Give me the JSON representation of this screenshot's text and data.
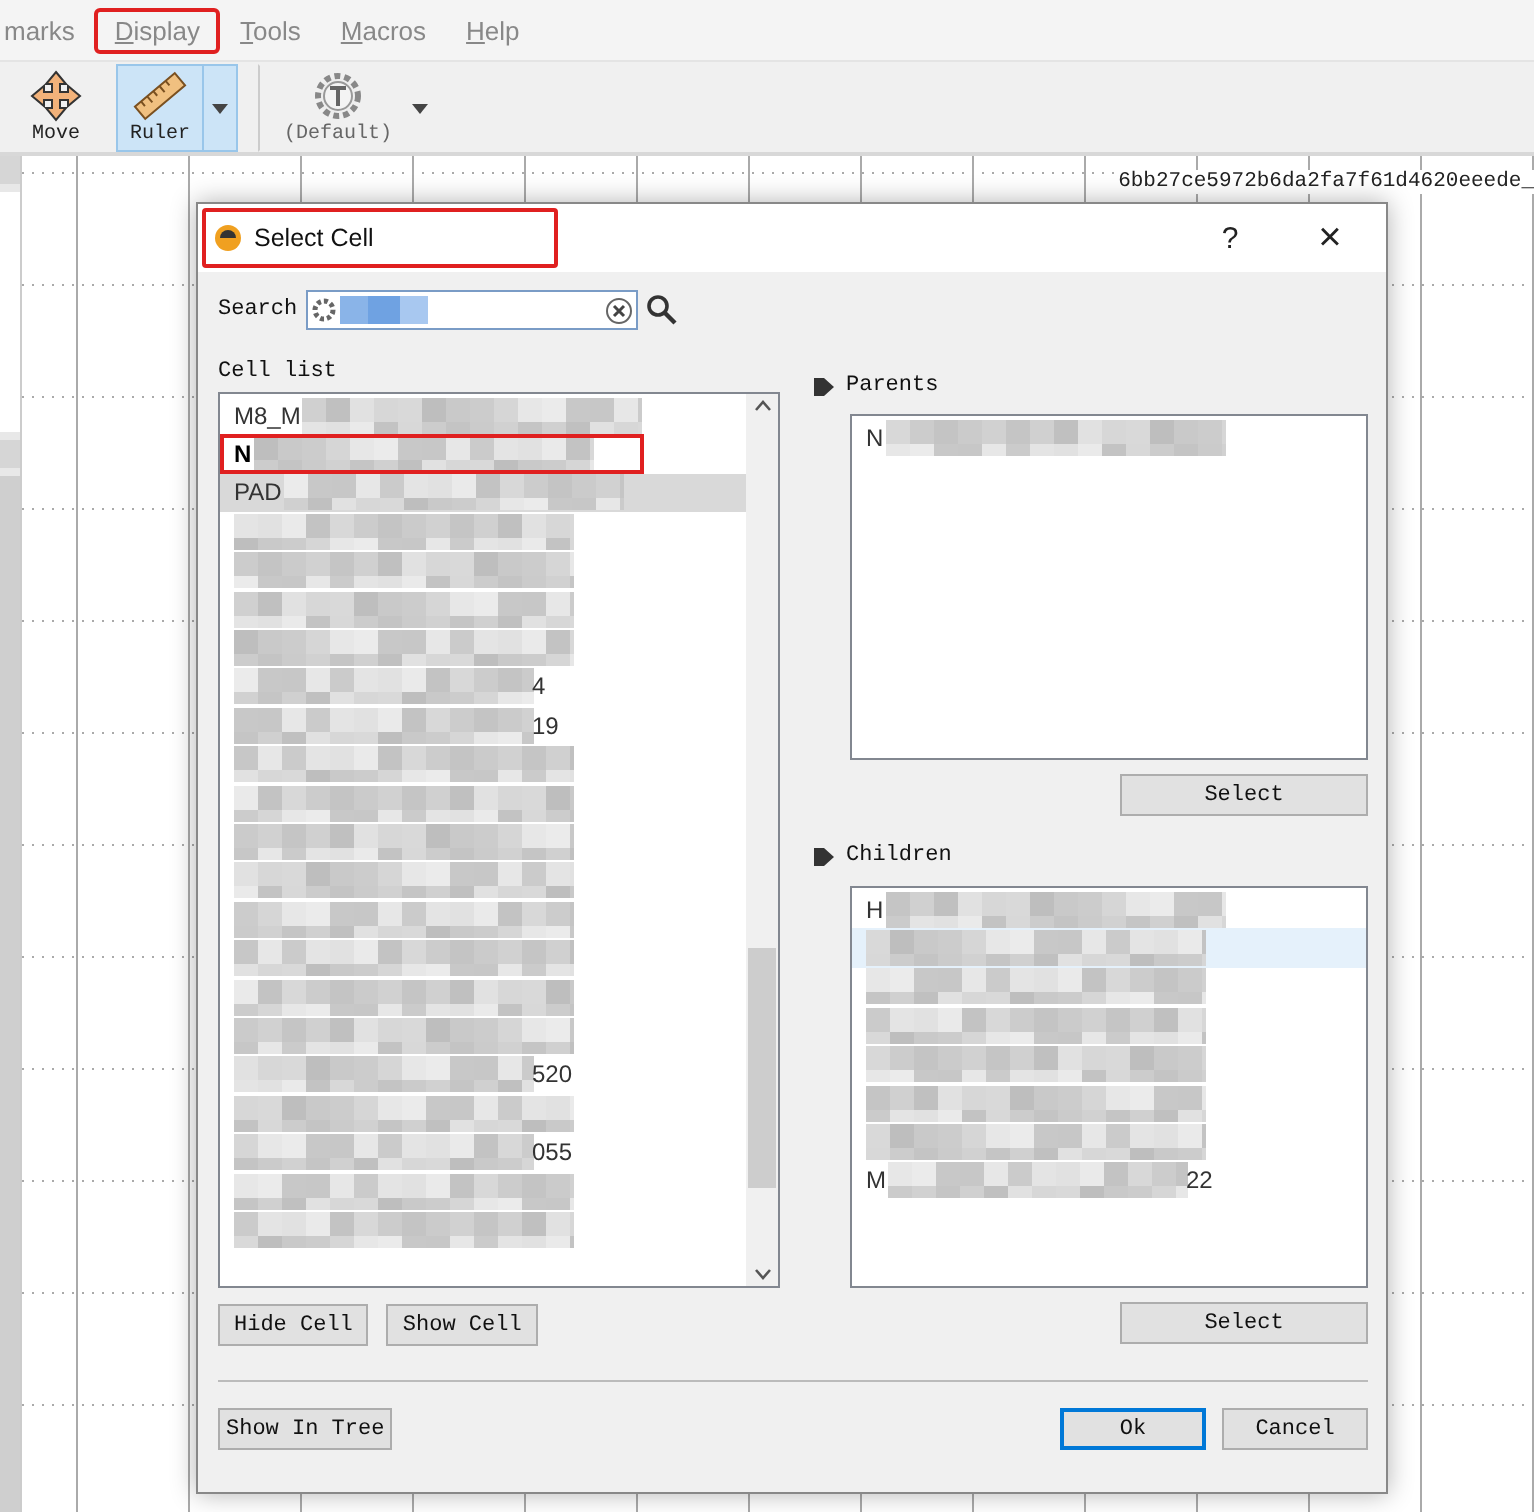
{
  "menu": [
    {
      "label": "marks",
      "underline_first": false,
      "highlighted": false
    },
    {
      "label": "Display",
      "underline_first": true,
      "highlighted": true
    },
    {
      "label": "Tools",
      "underline_first": true,
      "highlighted": false
    },
    {
      "label": "Macros",
      "underline_first": true,
      "highlighted": false
    },
    {
      "label": "Help",
      "underline_first": true,
      "highlighted": false
    }
  ],
  "toolbar": [
    {
      "kind": "move",
      "label": "Move",
      "selected": false
    },
    {
      "kind": "ruler",
      "label": "Ruler",
      "selected": true
    },
    {
      "kind": "template",
      "label": "(Default)",
      "selected": false
    }
  ],
  "layout_title": "6bb27ce5972b6da2fa7f61d4620eeede_",
  "dialog": {
    "title": "Select Cell",
    "title_highlighted": true,
    "help": "?",
    "close": "×",
    "search_label": "Search",
    "cell_list_label": "Cell list",
    "cells": [
      {
        "prefix": "M8_M",
        "bold": false,
        "selected": false,
        "highlighted": false
      },
      {
        "prefix": "N",
        "bold": true,
        "selected": false,
        "highlighted": true
      },
      {
        "prefix": "PAD",
        "bold": false,
        "selected": true,
        "highlighted": false
      },
      {
        "selected": false,
        "highlighted": false
      },
      {
        "selected": false,
        "highlighted": false
      },
      {
        "selected": false,
        "highlighted": false
      },
      {
        "selected": false,
        "highlighted": false
      },
      {
        "suffix": "4",
        "selected": false,
        "highlighted": false
      },
      {
        "suffix": "19",
        "selected": false,
        "highlighted": false
      },
      {
        "selected": false,
        "highlighted": false
      },
      {
        "selected": false,
        "highlighted": false
      },
      {
        "selected": false,
        "highlighted": false
      },
      {
        "selected": false,
        "highlighted": false
      },
      {
        "selected": false,
        "highlighted": false
      },
      {
        "selected": false,
        "highlighted": false
      },
      {
        "selected": false,
        "highlighted": false
      },
      {
        "selected": false,
        "highlighted": false
      },
      {
        "suffix": "520",
        "selected": false,
        "highlighted": false
      },
      {
        "selected": false,
        "highlighted": false
      },
      {
        "suffix": "055",
        "selected": false,
        "highlighted": false
      },
      {
        "selected": false,
        "highlighted": false
      },
      {
        "selected": false,
        "highlighted": false
      }
    ],
    "parents_label": "Parents",
    "parents": [
      {
        "prefix": "N",
        "selected": false
      }
    ],
    "children_label": "Children",
    "children": [
      {
        "prefix": "H",
        "selected": false
      },
      {
        "selected": true
      },
      {
        "selected": false
      },
      {
        "selected": false
      },
      {
        "selected": false
      },
      {
        "selected": false
      },
      {
        "selected": false
      },
      {
        "prefix": "M",
        "suffix": "22",
        "selected": false
      }
    ],
    "buttons": {
      "parents_select": "Select",
      "children_select": "Select",
      "hide_cell": "Hide Cell",
      "show_cell": "Show Cell",
      "show_in_tree": "Show In Tree",
      "ok": "Ok",
      "cancel": "Cancel"
    }
  }
}
